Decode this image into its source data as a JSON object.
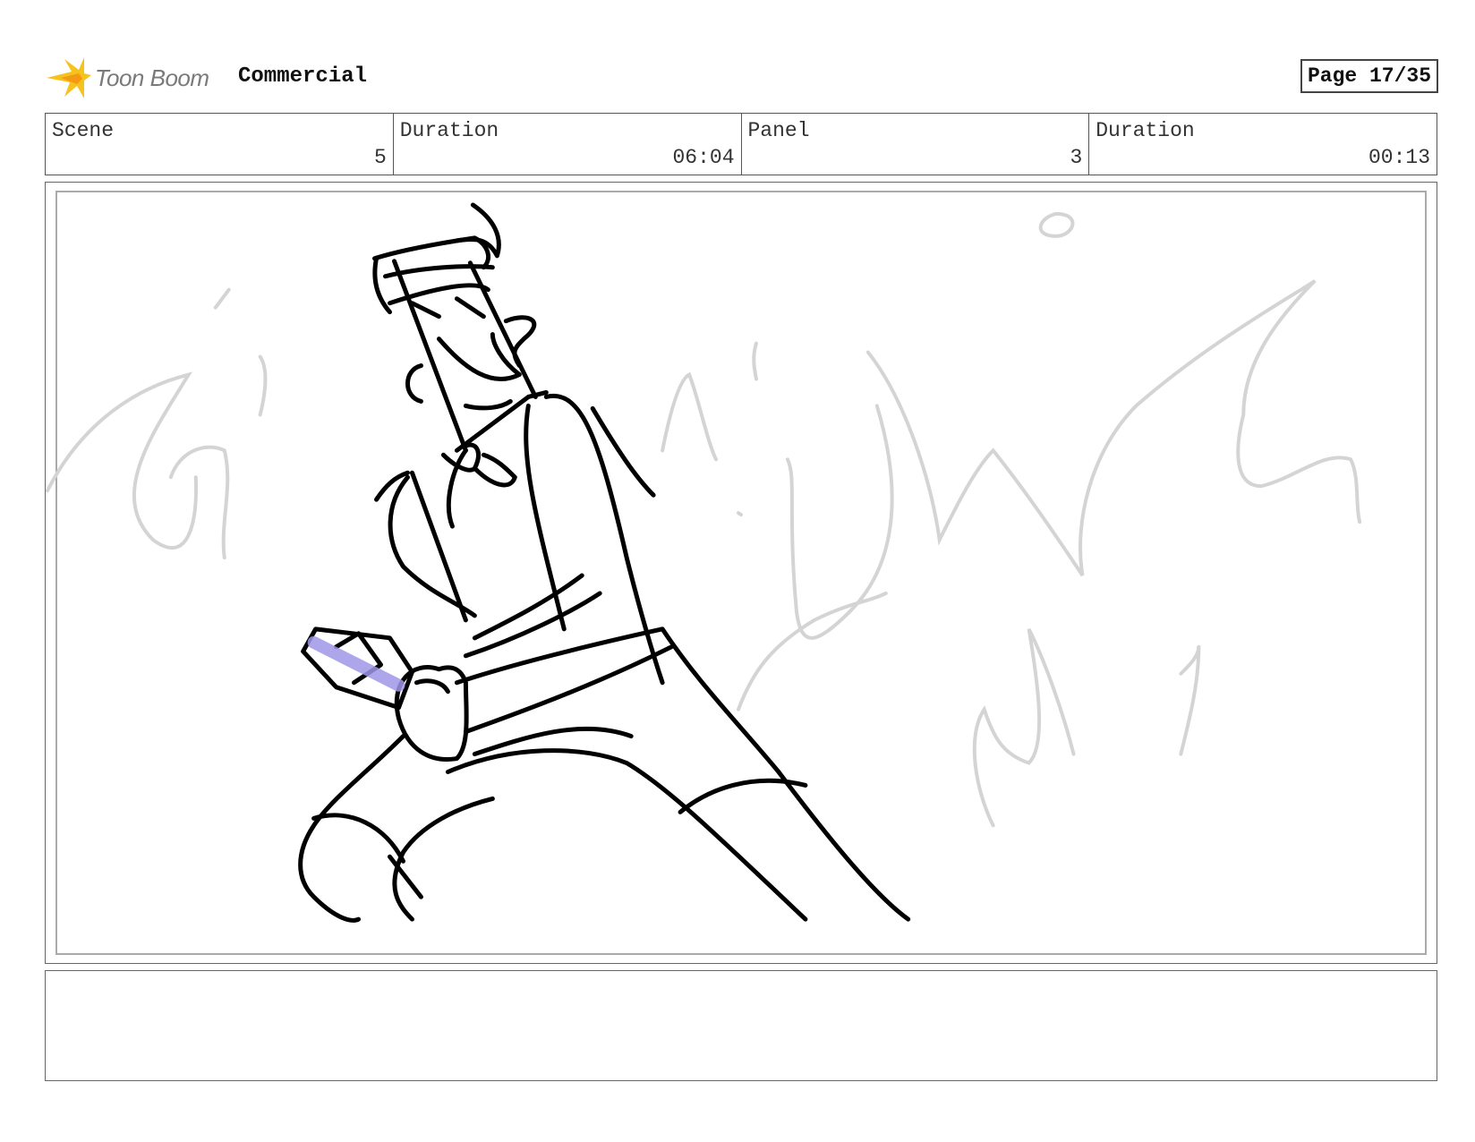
{
  "header": {
    "logo_text": "Toon Boom",
    "project_title": "Commercial",
    "page_label": "Page 17/35"
  },
  "info": {
    "scene_label": "Scene",
    "scene_value": "5",
    "scene_duration_label": "Duration",
    "scene_duration_value": "06:04",
    "panel_label": "Panel",
    "panel_value": "3",
    "panel_duration_label": "Duration",
    "panel_duration_value": "00:13"
  },
  "colors": {
    "sketch_line": "#000000",
    "background_sketch": "#d4d4d4",
    "highlight": "#9f96e6",
    "logo_yellow": "#f6c21c"
  },
  "icons": [
    "toon-boom-logo-icon"
  ]
}
